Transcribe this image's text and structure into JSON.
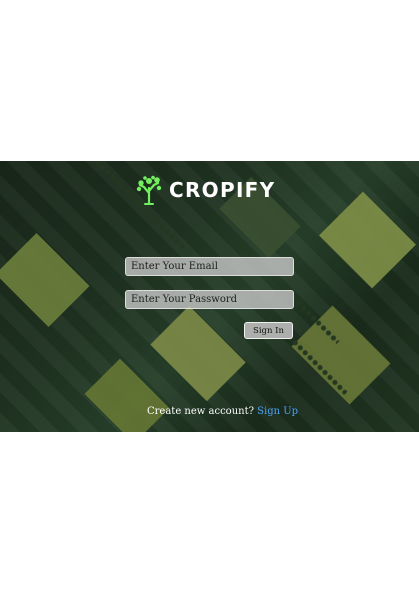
{
  "brand": {
    "name": "CROPIFY",
    "logo_icon": "tree-icon",
    "accent_color": "#73ee5f"
  },
  "login": {
    "email_placeholder": "Enter Your Email",
    "password_placeholder": "Enter Your Password",
    "sign_in_label": "Sign In"
  },
  "signup": {
    "prompt": "Create new account?",
    "link_label": "Sign Up"
  }
}
